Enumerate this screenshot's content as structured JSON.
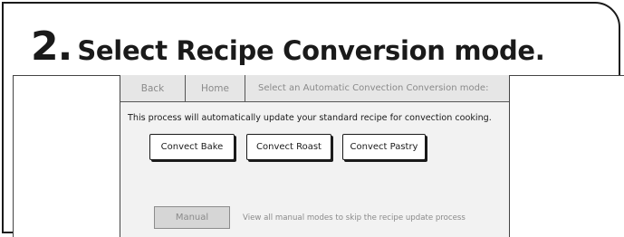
{
  "step": {
    "number": "2.",
    "title": "Select Recipe Conversion mode."
  },
  "screen": {
    "topbar": {
      "back_label": "Back",
      "home_label": "Home",
      "prompt": "Select an Automatic Convection Conversion mode:"
    },
    "description": "This process will automatically update your standard recipe for convection cooking.",
    "buttons": {
      "convect_bake": "Convect Bake",
      "convect_roast": "Convect Roast",
      "convect_pastry": "Convect Pastry"
    },
    "manual": {
      "label": "Manual",
      "hint": "View all manual modes to skip the recipe update process"
    }
  }
}
